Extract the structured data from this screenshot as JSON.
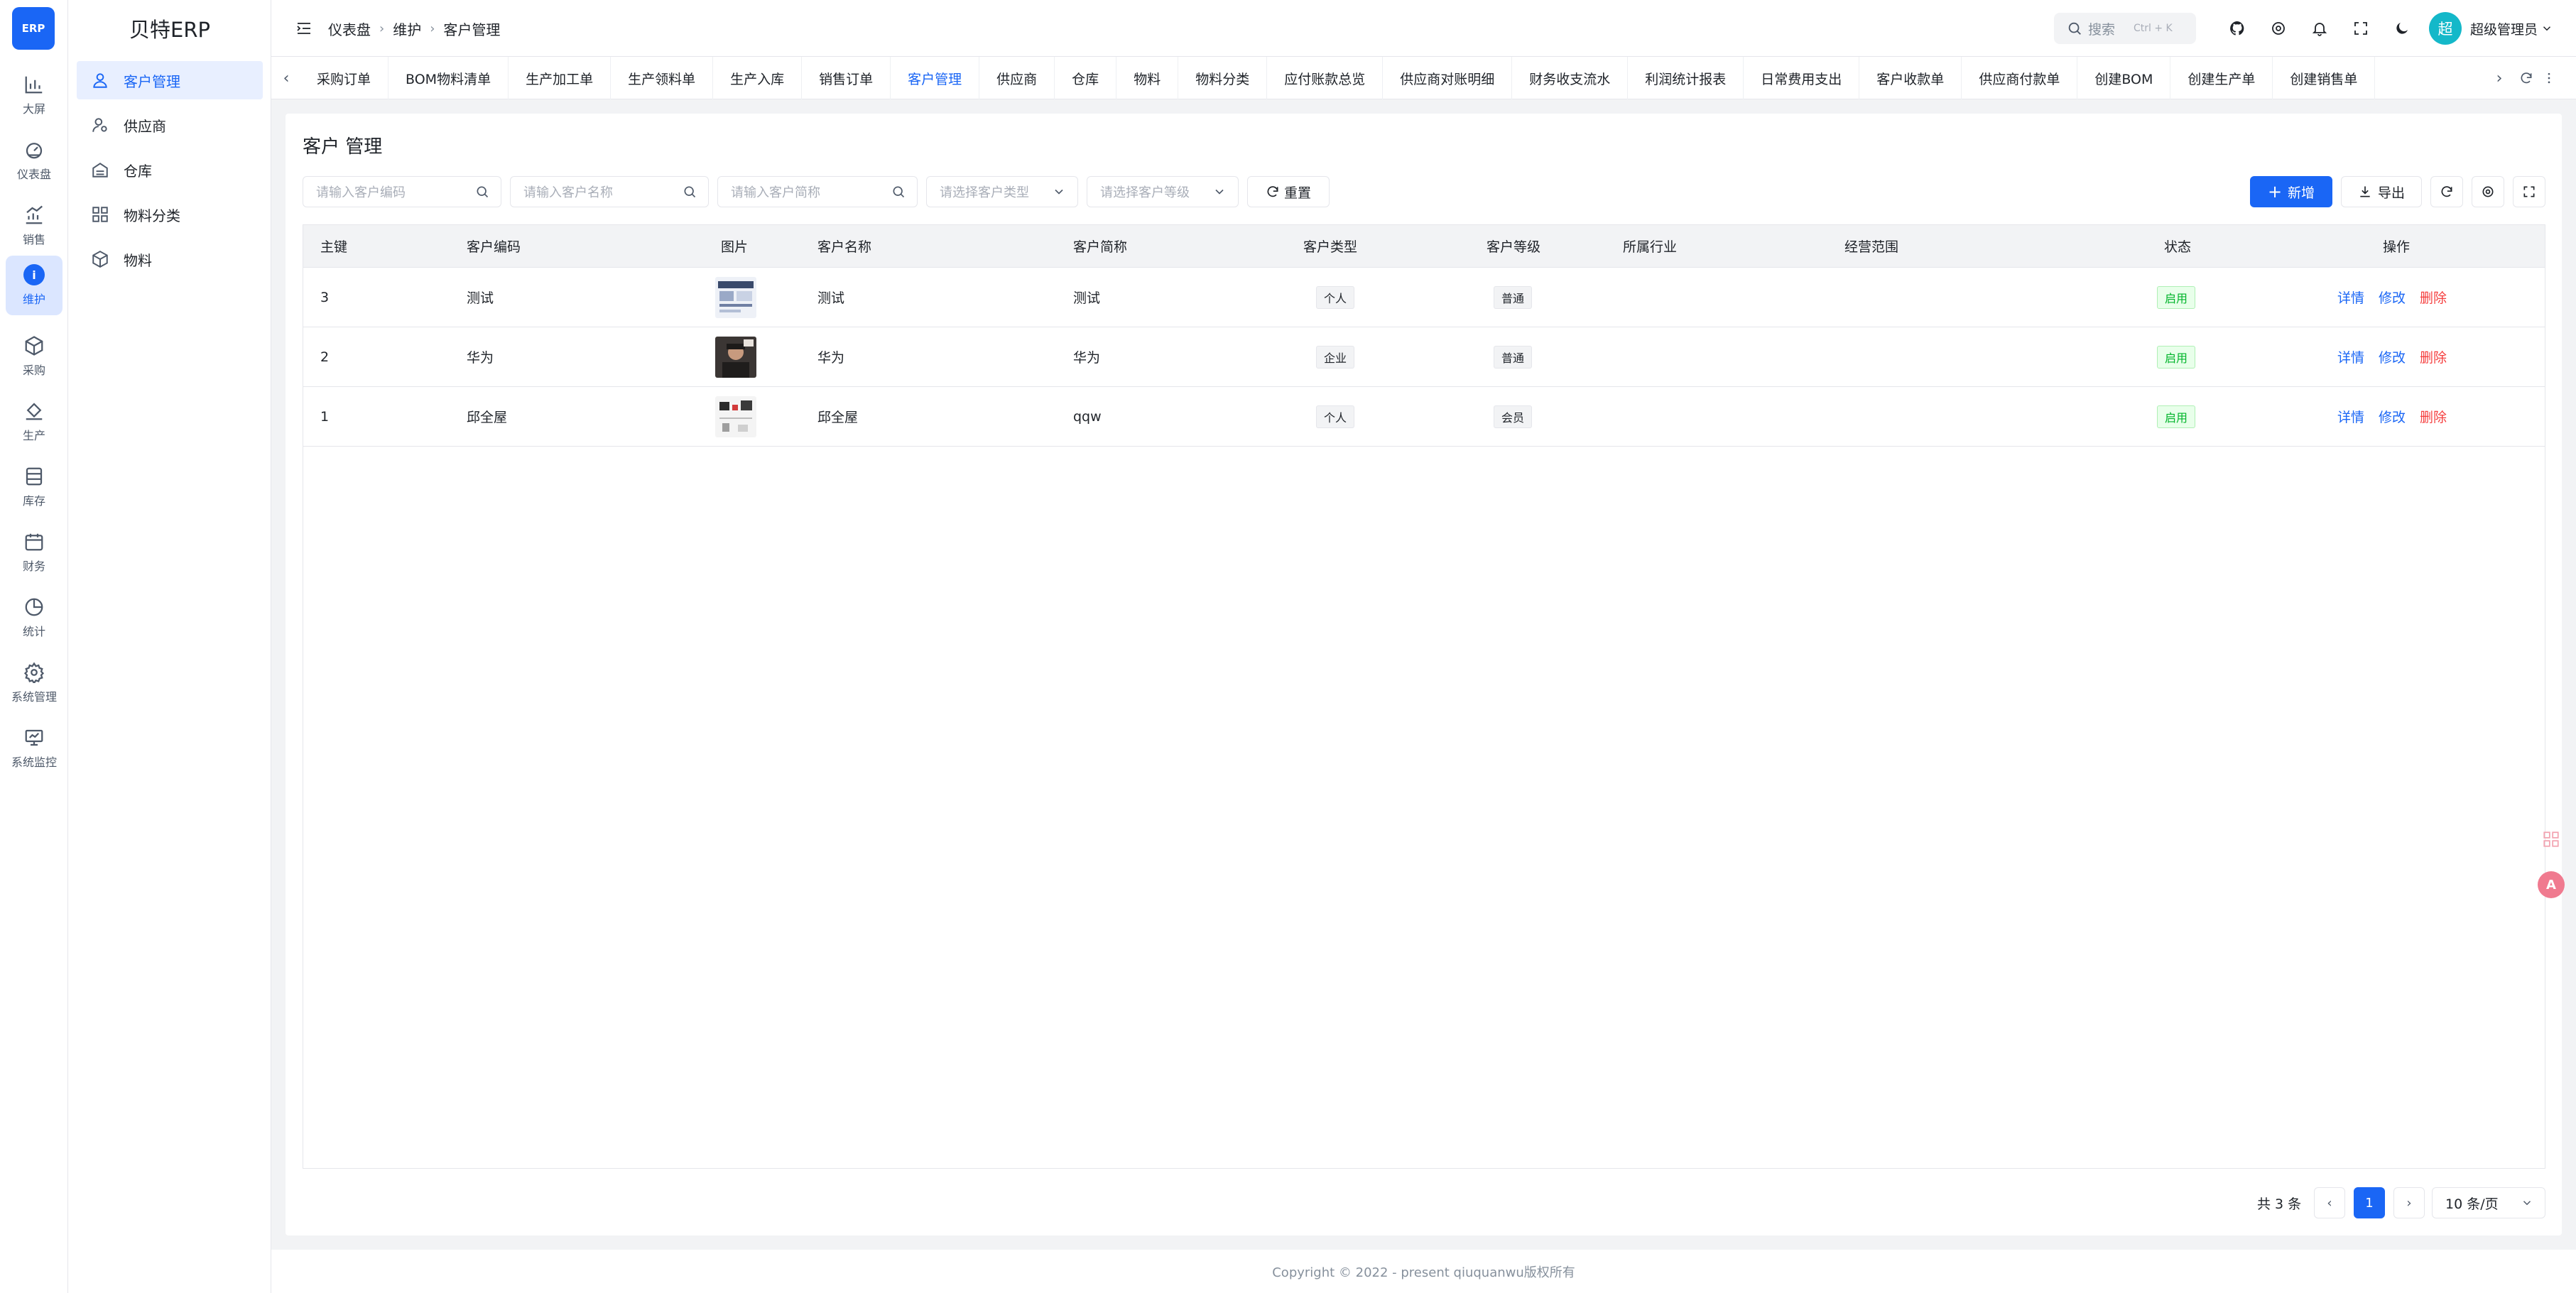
{
  "app": {
    "logo_text": "ERP",
    "brand": "贝特ERP"
  },
  "rail": {
    "items": [
      {
        "label": "大屏",
        "icon": "bar-chart-icon"
      },
      {
        "label": "仪表盘",
        "icon": "dashboard-icon"
      },
      {
        "label": "销售",
        "icon": "sales-chart-icon"
      },
      {
        "label": "维护",
        "icon": "info-icon",
        "active": true
      },
      {
        "label": "采购",
        "icon": "cube-icon"
      },
      {
        "label": "生产",
        "icon": "paint-bucket-icon"
      },
      {
        "label": "库存",
        "icon": "archive-icon"
      },
      {
        "label": "财务",
        "icon": "calendar-icon"
      },
      {
        "label": "统计",
        "icon": "pie-chart-icon"
      },
      {
        "label": "系统管理",
        "icon": "gear-icon"
      },
      {
        "label": "系统监控",
        "icon": "monitor-icon"
      }
    ]
  },
  "subnav": {
    "items": [
      {
        "label": "客户管理",
        "icon": "customer-icon",
        "active": true
      },
      {
        "label": "供应商",
        "icon": "supplier-icon"
      },
      {
        "label": "仓库",
        "icon": "warehouse-icon"
      },
      {
        "label": "物料分类",
        "icon": "grid-icon"
      },
      {
        "label": "物料",
        "icon": "box-icon"
      }
    ]
  },
  "header": {
    "breadcrumb": [
      "仪表盘",
      "维护",
      "客户管理"
    ],
    "search_placeholder": "搜索",
    "search_shortcut": "Ctrl + K",
    "avatar_text": "超",
    "username": "超级管理员"
  },
  "tabs": {
    "items": [
      "采购订单",
      "BOM物料清单",
      "生产加工单",
      "生产领料单",
      "生产入库",
      "销售订单",
      "客户管理",
      "供应商",
      "仓库",
      "物料",
      "物料分类",
      "应付账款总览",
      "供应商对账明细",
      "财务收支流水",
      "利润统计报表",
      "日常费用支出",
      "客户收款单",
      "供应商付款单",
      "创建BOM",
      "创建生产单",
      "创建销售单"
    ],
    "active": "客户管理"
  },
  "page": {
    "title": "客户 管理",
    "filters": {
      "code_placeholder": "请输入客户编码",
      "name_placeholder": "请输入客户名称",
      "short_placeholder": "请输入客户简称",
      "type_placeholder": "请选择客户类型",
      "level_placeholder": "请选择客户等级",
      "reset_label": "重置"
    },
    "actions": {
      "add_label": "新增",
      "export_label": "导出"
    },
    "table": {
      "columns": [
        "主键",
        "客户编码",
        "图片",
        "客户名称",
        "客户简称",
        "客户类型",
        "客户等级",
        "所属行业",
        "经营范围",
        "状态",
        "操作"
      ],
      "rows": [
        {
          "id": "3",
          "code": "测试",
          "name": "测试",
          "short": "测试",
          "type": "个人",
          "level": "普通",
          "industry": "",
          "scope": "",
          "status": "启用"
        },
        {
          "id": "2",
          "code": "华为",
          "name": "华为",
          "short": "华为",
          "type": "企业",
          "level": "普通",
          "industry": "",
          "scope": "",
          "status": "启用"
        },
        {
          "id": "1",
          "code": "邱全屋",
          "name": "邱全屋",
          "short": "qqw",
          "type": "个人",
          "level": "会员",
          "industry": "",
          "scope": "",
          "status": "启用"
        }
      ],
      "row_actions": {
        "detail": "详情",
        "edit": "修改",
        "delete": "删除"
      }
    },
    "pagination": {
      "total_text": "共 3 条",
      "current_page": "1",
      "page_size": "10 条/页"
    }
  },
  "footer": {
    "text": "Copyright © 2022 - present qiuquanwu版权所有"
  },
  "colors": {
    "primary": "#1a66f5",
    "danger": "#f53f3f",
    "success": "#00b42a"
  }
}
